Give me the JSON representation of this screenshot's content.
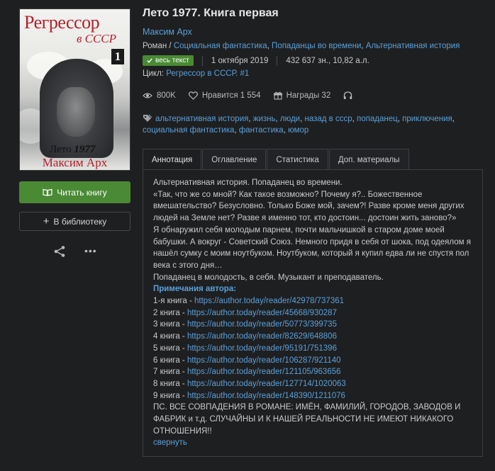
{
  "cover": {
    "title": "Регрессор",
    "subtitle": "в СССР",
    "number": "1",
    "summer": "Лето",
    "year": "1977",
    "author": "Максим Арх"
  },
  "actions": {
    "read_label": "Читать книгу",
    "library_label": "В библиотеку"
  },
  "book": {
    "title": "Лето 1977. Книга первая",
    "author": "Максим Арх",
    "genres": [
      "Роман",
      "Социальная фантастика",
      "Попаданцы во времени",
      "Альтернативная история"
    ],
    "genre_separator": " / ",
    "badge": "весь текст",
    "date": "1 октября 2019",
    "size": "432 637 зн., 10,82 а.л.",
    "cycle_label": "Цикл:",
    "cycle": "Регрессор в СССР. #1"
  },
  "stats": {
    "views": "800K",
    "likes": "Нравится 1 554",
    "awards": "Награды 32"
  },
  "tags": [
    "альтернативная история",
    "жизнь",
    "люди",
    "назад в ссср",
    "попаданец",
    "приключения",
    "социальная фантастика",
    "фантастика",
    "юмор"
  ],
  "tabs": [
    "Аннотация",
    "Оглавление",
    "Статистика",
    "Доп. материалы"
  ],
  "annotation": {
    "lines": [
      "Альтернативная история. Попаданец во времени.",
      "«Так, что же со мной? Как такое возможно? Почему я?.. Божественное вмешательство? Безусловно. Только Боже мой, зачем?! Разве кроме меня других людей на Земле нет? Разве я именно тот, кто достоин... достоин жить заново?»",
      "Я обнаружил себя молодым парнем, почти мальчишкой в старом доме моей бабушки. А вокруг - Советский Союз. Немного придя в себя от шока, под одеялом я нашёл сумку с моим ноутбуком. Ноутбуком, который я купил едва ли не спустя пол века с этого дня…",
      "Попаданец в молодость, в себя. Музыкант и преподаватель."
    ],
    "notes_title": "Примечания автора:",
    "links": [
      {
        "prefix": "1-я книга - ",
        "url": "https://author.today/reader/42978/737361"
      },
      {
        "prefix": "2 книга - ",
        "url": "https://author.today/reader/45668/930287"
      },
      {
        "prefix": "3 книга - ",
        "url": "https://author.today/reader/50773/399735"
      },
      {
        "prefix": "4 книга - ",
        "url": "https://author.today/reader/82629/648806"
      },
      {
        "prefix": "5 книга - ",
        "url": "https://author.today/reader/95191/751396"
      },
      {
        "prefix": "6 книга - ",
        "url": "https://author.today/reader/106287/921140"
      },
      {
        "prefix": "7 книга - ",
        "url": "https://author.today/reader/121105/963656"
      },
      {
        "prefix": "8 книга - ",
        "url": "https://author.today/reader/127714/1020063"
      },
      {
        "prefix": "9 книга - ",
        "url": "https://author.today/reader/148390/1211076"
      }
    ],
    "ps": "ПС. ВСЕ СОВПАДЕНИЯ В РОМАНЕ: ИМЁН, ФАМИЛИЙ, ГОРОДОВ, ЗАВОДОВ И ФАБРИК и т.д. СЛУЧАЙНЫ И К НАШЕЙ РЕАЛЬНОСТИ НЕ ИМЕЮТ НИКАКОГО ОТНОШЕНИЯ!!",
    "collapse_label": "свернуть"
  },
  "colors": {
    "background": "#1e1f21",
    "link": "#5aa0d8",
    "accent_green": "#4a8a35",
    "cover_red": "#b3202a"
  }
}
